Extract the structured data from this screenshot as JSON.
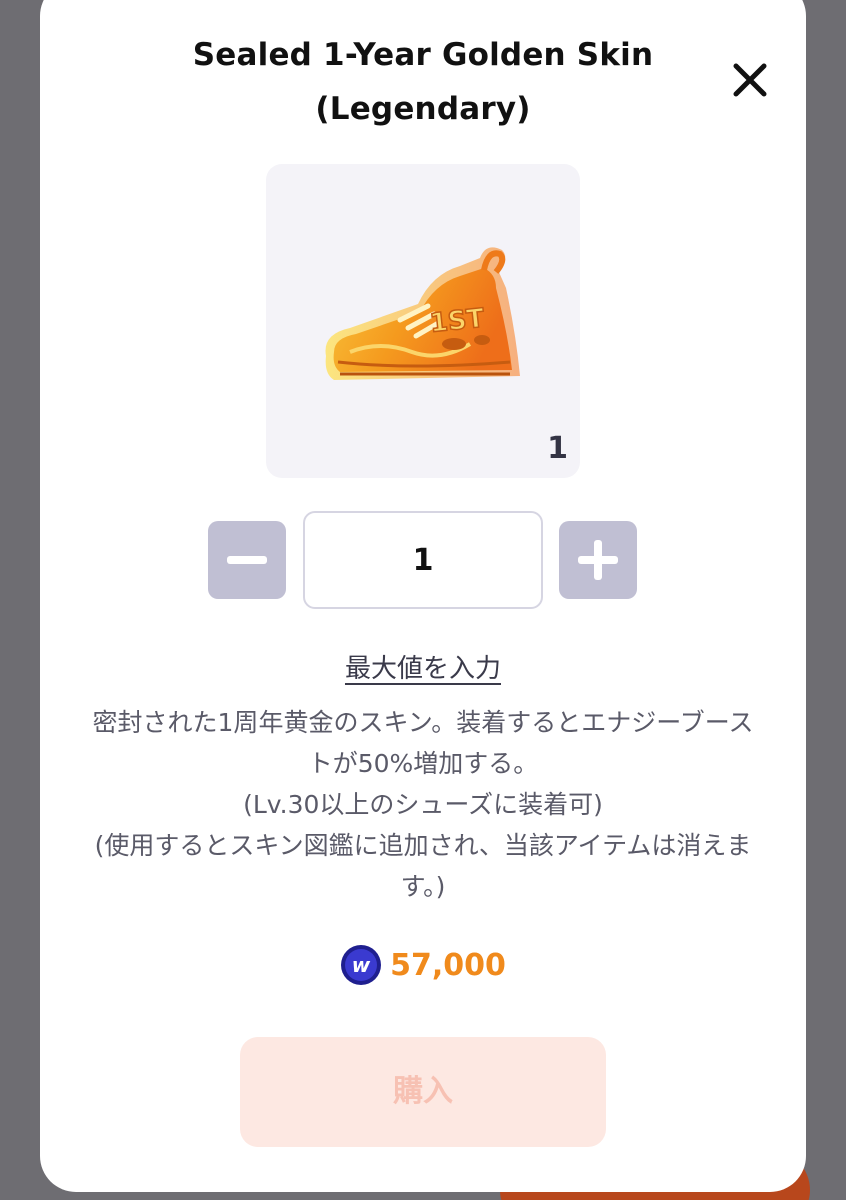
{
  "modal": {
    "title_line1": "Sealed 1-Year Golden Skin",
    "title_line2": "(Legendary)",
    "close_icon": "close-icon"
  },
  "item": {
    "icon": "golden-sneaker-icon",
    "badge_text": "1ST",
    "count": "1"
  },
  "quantity": {
    "value": "1",
    "minus_icon": "minus-icon",
    "plus_icon": "plus-icon"
  },
  "max_link": "最大値を入力",
  "description": {
    "line1": "密封された1周年黄金のスキン。装着するとエナジーブース",
    "line2": "トが50%増加する。",
    "line3": "(Lv.30以上のシューズに装着可)",
    "line4": "(使用するとスキン図鑑に追加され、当該アイテムは消えま",
    "line5": "す。)"
  },
  "price": {
    "currency_icon": "coin-icon",
    "currency_letter": "w",
    "value": "57,000"
  },
  "buy_button": {
    "label": "購入"
  },
  "colors": {
    "accent_orange": "#f08a1c",
    "qty_button": "#c0bfd3",
    "buy_disabled_bg": "#fde8e2",
    "buy_disabled_text": "#f7c1b3",
    "coin_blue": "#2f2fb3"
  }
}
